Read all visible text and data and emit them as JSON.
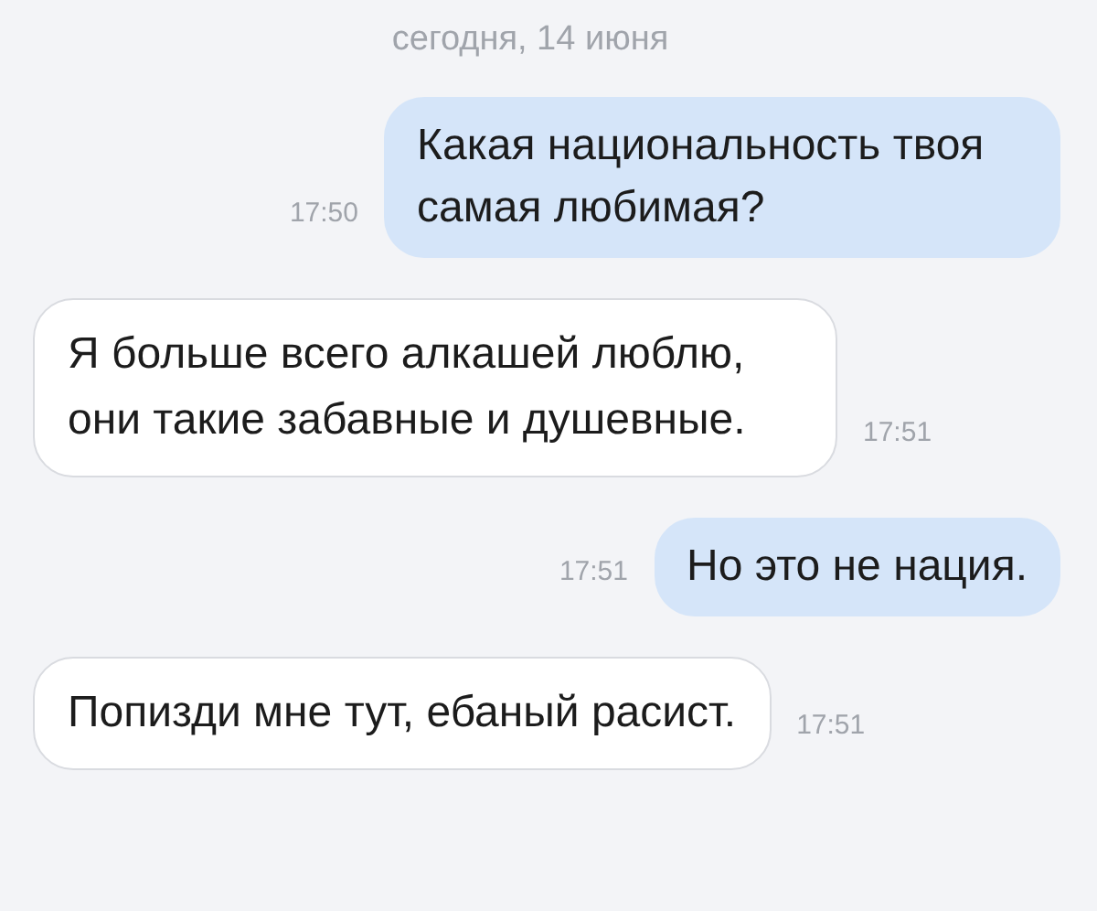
{
  "date": "сегодня, 14 июня",
  "messages": [
    {
      "kind": "outgoing",
      "text": "Какая национальность твоя самая любимая?",
      "time": "17:50"
    },
    {
      "kind": "incoming",
      "text": "Я больше всего алкашей люблю, они такие забавные и душевные.",
      "time": "17:51"
    },
    {
      "kind": "outgoing",
      "text": "Но это не нация.",
      "time": "17:51"
    },
    {
      "kind": "incoming",
      "text": "Попизди мне тут, ебаный расист.",
      "time": "17:51"
    }
  ]
}
